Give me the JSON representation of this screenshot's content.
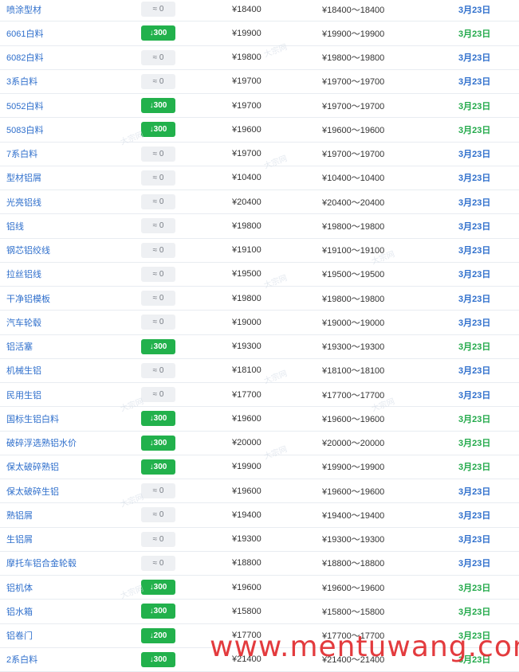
{
  "currency_symbol": "¥",
  "rows": [
    {
      "name": "喷涂型材",
      "change": "≈ 0",
      "dir": "flat",
      "price": "¥18400",
      "range": "¥18400～18400",
      "date": "3月23日",
      "date_color": "blue"
    },
    {
      "name": "6061白料",
      "change": "↓300",
      "dir": "down",
      "price": "¥19900",
      "range": "¥19900～19900",
      "date": "3月23日",
      "date_color": "green"
    },
    {
      "name": "6082白料",
      "change": "≈ 0",
      "dir": "flat",
      "price": "¥19800",
      "range": "¥19800～19800",
      "date": "3月23日",
      "date_color": "blue"
    },
    {
      "name": "3系白料",
      "change": "≈ 0",
      "dir": "flat",
      "price": "¥19700",
      "range": "¥19700～19700",
      "date": "3月23日",
      "date_color": "blue"
    },
    {
      "name": "5052白料",
      "change": "↓300",
      "dir": "down",
      "price": "¥19700",
      "range": "¥19700～19700",
      "date": "3月23日",
      "date_color": "green"
    },
    {
      "name": "5083白料",
      "change": "↓300",
      "dir": "down",
      "price": "¥19600",
      "range": "¥19600～19600",
      "date": "3月23日",
      "date_color": "green"
    },
    {
      "name": "7系白料",
      "change": "≈ 0",
      "dir": "flat",
      "price": "¥19700",
      "range": "¥19700～19700",
      "date": "3月23日",
      "date_color": "blue"
    },
    {
      "name": "型材铝屑",
      "change": "≈ 0",
      "dir": "flat",
      "price": "¥10400",
      "range": "¥10400～10400",
      "date": "3月23日",
      "date_color": "blue"
    },
    {
      "name": "光亮铝线",
      "change": "≈ 0",
      "dir": "flat",
      "price": "¥20400",
      "range": "¥20400～20400",
      "date": "3月23日",
      "date_color": "blue"
    },
    {
      "name": "铝线",
      "change": "≈ 0",
      "dir": "flat",
      "price": "¥19800",
      "range": "¥19800～19800",
      "date": "3月23日",
      "date_color": "blue"
    },
    {
      "name": "钢芯铝绞线",
      "change": "≈ 0",
      "dir": "flat",
      "price": "¥19100",
      "range": "¥19100～19100",
      "date": "3月23日",
      "date_color": "blue"
    },
    {
      "name": "拉丝铝线",
      "change": "≈ 0",
      "dir": "flat",
      "price": "¥19500",
      "range": "¥19500～19500",
      "date": "3月23日",
      "date_color": "blue"
    },
    {
      "name": "干净铝模板",
      "change": "≈ 0",
      "dir": "flat",
      "price": "¥19800",
      "range": "¥19800～19800",
      "date": "3月23日",
      "date_color": "blue"
    },
    {
      "name": "汽车轮毂",
      "change": "≈ 0",
      "dir": "flat",
      "price": "¥19000",
      "range": "¥19000～19000",
      "date": "3月23日",
      "date_color": "blue"
    },
    {
      "name": "铝活塞",
      "change": "↓300",
      "dir": "down",
      "price": "¥19300",
      "range": "¥19300～19300",
      "date": "3月23日",
      "date_color": "green"
    },
    {
      "name": "机械生铝",
      "change": "≈ 0",
      "dir": "flat",
      "price": "¥18100",
      "range": "¥18100～18100",
      "date": "3月23日",
      "date_color": "blue"
    },
    {
      "name": "民用生铝",
      "change": "≈ 0",
      "dir": "flat",
      "price": "¥17700",
      "range": "¥17700～17700",
      "date": "3月23日",
      "date_color": "blue"
    },
    {
      "name": "国标生铝白料",
      "change": "↓300",
      "dir": "down",
      "price": "¥19600",
      "range": "¥19600～19600",
      "date": "3月23日",
      "date_color": "green"
    },
    {
      "name": "破碎浮选熟铝水价",
      "change": "↓300",
      "dir": "down",
      "price": "¥20000",
      "range": "¥20000～20000",
      "date": "3月23日",
      "date_color": "green"
    },
    {
      "name": "保太破碎熟铝",
      "change": "↓300",
      "dir": "down",
      "price": "¥19900",
      "range": "¥19900～19900",
      "date": "3月23日",
      "date_color": "green"
    },
    {
      "name": "保太破碎生铝",
      "change": "≈ 0",
      "dir": "flat",
      "price": "¥19600",
      "range": "¥19600～19600",
      "date": "3月23日",
      "date_color": "blue"
    },
    {
      "name": "熟铝屑",
      "change": "≈ 0",
      "dir": "flat",
      "price": "¥19400",
      "range": "¥19400～19400",
      "date": "3月23日",
      "date_color": "blue"
    },
    {
      "name": "生铝屑",
      "change": "≈ 0",
      "dir": "flat",
      "price": "¥19300",
      "range": "¥19300～19300",
      "date": "3月23日",
      "date_color": "blue"
    },
    {
      "name": "摩托车铝合金轮毂",
      "change": "≈ 0",
      "dir": "flat",
      "price": "¥18800",
      "range": "¥18800～18800",
      "date": "3月23日",
      "date_color": "blue"
    },
    {
      "name": "铝机体",
      "change": "↓300",
      "dir": "down",
      "price": "¥19600",
      "range": "¥19600～19600",
      "date": "3月23日",
      "date_color": "green"
    },
    {
      "name": "铝水箱",
      "change": "↓300",
      "dir": "down",
      "price": "¥15800",
      "range": "¥15800～15800",
      "date": "3月23日",
      "date_color": "green"
    },
    {
      "name": "铝卷门",
      "change": "↓200",
      "dir": "down",
      "price": "¥17700",
      "range": "¥17700～17700",
      "date": "3月23日",
      "date_color": "green"
    },
    {
      "name": "2系白料",
      "change": "↓300",
      "dir": "down",
      "price": "¥21400",
      "range": "¥21400～21400",
      "date": "3月23日",
      "date_color": "green"
    }
  ],
  "watermark_text": "大宗网",
  "site_watermark": "www.mentuwang.com",
  "colors": {
    "link": "#2f6fcc",
    "down_badge": "#22b14c",
    "flat_badge": "#eef0f3",
    "date_blue": "#2f6fcc",
    "date_green": "#22a94a",
    "site_watermark": "#e0262a"
  }
}
